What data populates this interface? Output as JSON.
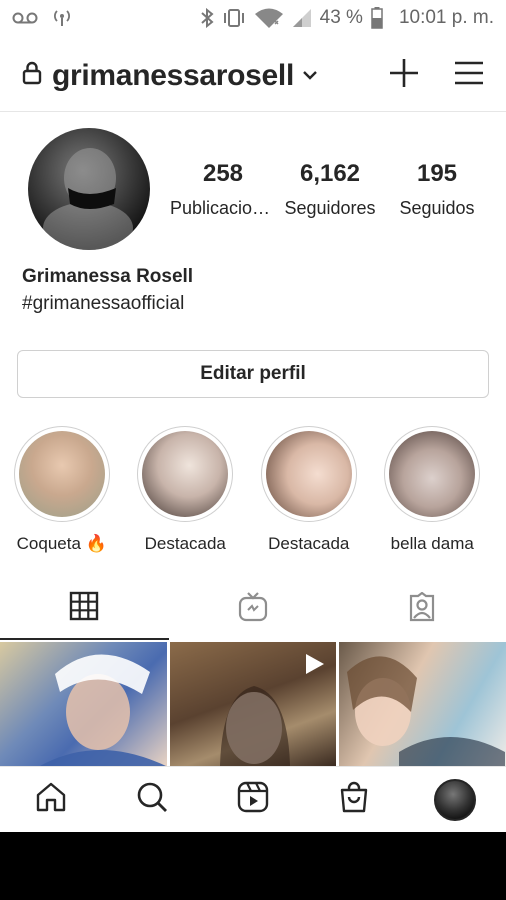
{
  "status": {
    "voicemail_icon": "voicemail-icon",
    "hotspot_icon": "hotspot-icon",
    "battery_percent": "43 %",
    "time": "10:01 p. m."
  },
  "header": {
    "username": "grimanessarosell"
  },
  "profile": {
    "posts_count": "258",
    "posts_label": "Publicaciones",
    "followers_count": "6,162",
    "followers_label": "Seguidores",
    "following_count": "195",
    "following_label": "Seguidos",
    "full_name": "Grimanessa Rosell",
    "bio": "#grimanessaofficial",
    "edit_button": "Editar perfil"
  },
  "highlights": [
    {
      "label": "Coqueta 🔥",
      "color_a": "#e8c9b0",
      "color_b": "#9aa08a"
    },
    {
      "label": "Destacada",
      "color_a": "#efe4dc",
      "color_b": "#3a2e2a"
    },
    {
      "label": "Destacada",
      "color_a": "#f4ddd0",
      "color_b": "#5a4034"
    },
    {
      "label": "bella dama",
      "color_a": "#dcd0cc",
      "color_b": "#4a3a36"
    }
  ],
  "colors": {
    "text": "#262626",
    "border": "#d0d0d0",
    "muted": "#666666"
  }
}
